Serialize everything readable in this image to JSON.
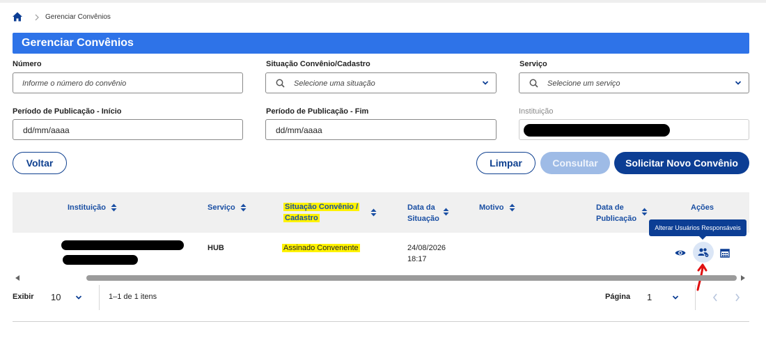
{
  "breadcrumb": {
    "current": "Gerenciar Convênios"
  },
  "header": {
    "title": "Gerenciar Convênios"
  },
  "form": {
    "numero": {
      "label": "Número",
      "placeholder": "Informe o número do convênio"
    },
    "situacao": {
      "label": "Situação Convênio/Cadastro",
      "placeholder": "Selecione uma situação"
    },
    "servico": {
      "label": "Serviço",
      "placeholder": "Selecione um serviço"
    },
    "periodo_inicio": {
      "label": "Período de Publicação - Início",
      "value": "dd/mm/aaaa"
    },
    "periodo_fim": {
      "label": "Período de Publicação - Fim",
      "value": "dd/mm/aaaa"
    },
    "instituicao": {
      "label": "Instituição",
      "value": ""
    }
  },
  "buttons": {
    "voltar": "Voltar",
    "limpar": "Limpar",
    "consultar": "Consultar",
    "solicitar": "Solicitar Novo Convênio"
  },
  "table": {
    "columns": {
      "instituicao": "Instituição",
      "servico": "Serviço",
      "situacao_l1": "Situação Convênio /",
      "situacao_l2": "Cadastro",
      "data_situacao_l1": "Data da",
      "data_situacao_l2": "Situação",
      "motivo": "Motivo",
      "data_publicacao_l1": "Data de",
      "data_publicacao_l2": "Publicação",
      "acoes": "Ações"
    },
    "rows": [
      {
        "instituicao": "",
        "servico": "HUB",
        "situacao": "Assinado Convenente",
        "data_situacao_date": "24/08/2026",
        "data_situacao_time": "18:17",
        "motivo": "",
        "data_publicacao": ""
      }
    ],
    "tooltip": "Alterar Usuários Responsáveis",
    "action_icons": [
      "eye-icon",
      "users-gear-icon",
      "calendar-icon"
    ]
  },
  "pagination": {
    "exibir_label": "Exibir",
    "page_size": "10",
    "range_text": "1–1 de 1 itens",
    "pagina_label": "Página",
    "current_page": "1"
  },
  "colors": {
    "header_bg": "#2e73e8",
    "primary": "#0c3e94",
    "highlight": "#fff200",
    "annotation": "#e01010"
  }
}
